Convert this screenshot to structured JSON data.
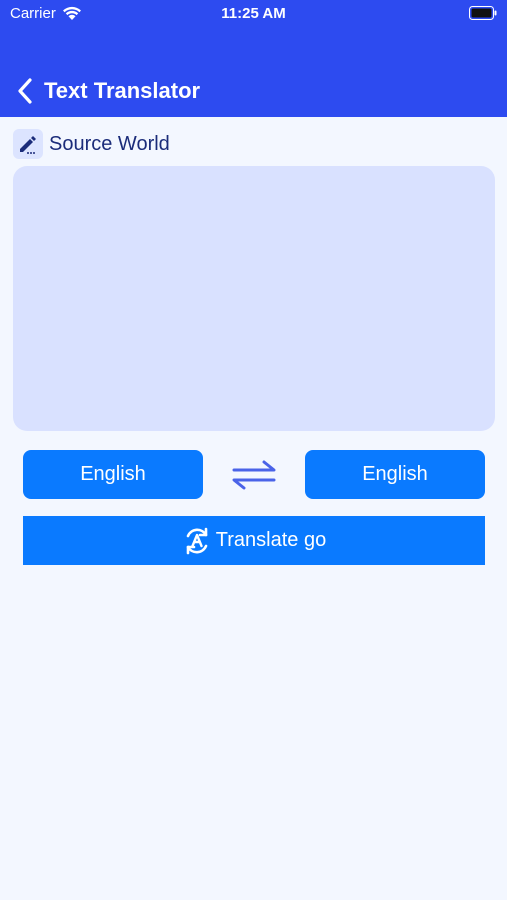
{
  "status_bar": {
    "carrier": "Carrier",
    "time": "11:25 AM",
    "icons": [
      "wifi-icon",
      "battery-icon"
    ]
  },
  "nav": {
    "title": "Text Translator",
    "back_icon": "chevron-left-icon"
  },
  "source": {
    "label": "Source World",
    "icon": "pencil-icon",
    "input_value": "",
    "input_placeholder": ""
  },
  "languages": {
    "source_label": "English",
    "target_label": "English",
    "swap_icon": "swap-arrows-icon"
  },
  "translate": {
    "label": "Translate go",
    "icon": "translate-refresh-icon"
  },
  "colors": {
    "header": "#2D4BF0",
    "button": "#0A7AFF",
    "textarea": "#D9E1FF",
    "background": "#F3F7FF"
  }
}
